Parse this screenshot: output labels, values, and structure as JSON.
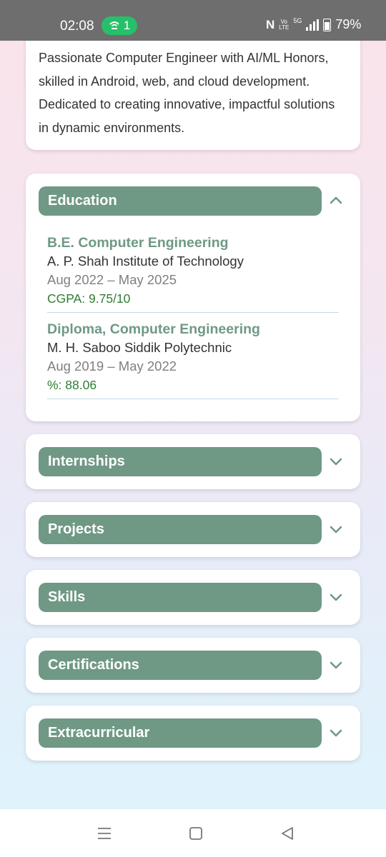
{
  "status_bar": {
    "time": "02:08",
    "hotspot_count": "1",
    "network_label": "5G",
    "volte_label": "Vo\nLTE",
    "battery": "79%"
  },
  "summary": {
    "text": "Passionate Computer Engineer with AI/ML Honors, skilled in Android, web, and cloud development. Dedicated to creating innovative, impactful solutions in dynamic environments."
  },
  "education": {
    "title": "Education",
    "expanded": true,
    "items": [
      {
        "degree": "B.E. Computer Engineering",
        "school": "A. P. Shah Institute of Technology",
        "dates": "Aug 2022 – May 2025",
        "score": "CGPA: 9.75/10"
      },
      {
        "degree": "Diploma, Computer Engineering",
        "school": "M. H. Saboo Siddik Polytechnic",
        "dates": "Aug 2019 – May 2022",
        "score": "%: 88.06"
      }
    ]
  },
  "sections": [
    {
      "title": "Internships",
      "expanded": false
    },
    {
      "title": "Projects",
      "expanded": false
    },
    {
      "title": "Skills",
      "expanded": false
    },
    {
      "title": "Certifications",
      "expanded": false
    },
    {
      "title": "Extracurricular",
      "expanded": false
    }
  ],
  "nav_bar": {
    "icons": [
      "recents-icon",
      "home-icon",
      "back-icon"
    ]
  },
  "colors": {
    "header_green": "#6f9985",
    "score_green": "#2f7d32",
    "hotspot_green": "#27c06a"
  }
}
